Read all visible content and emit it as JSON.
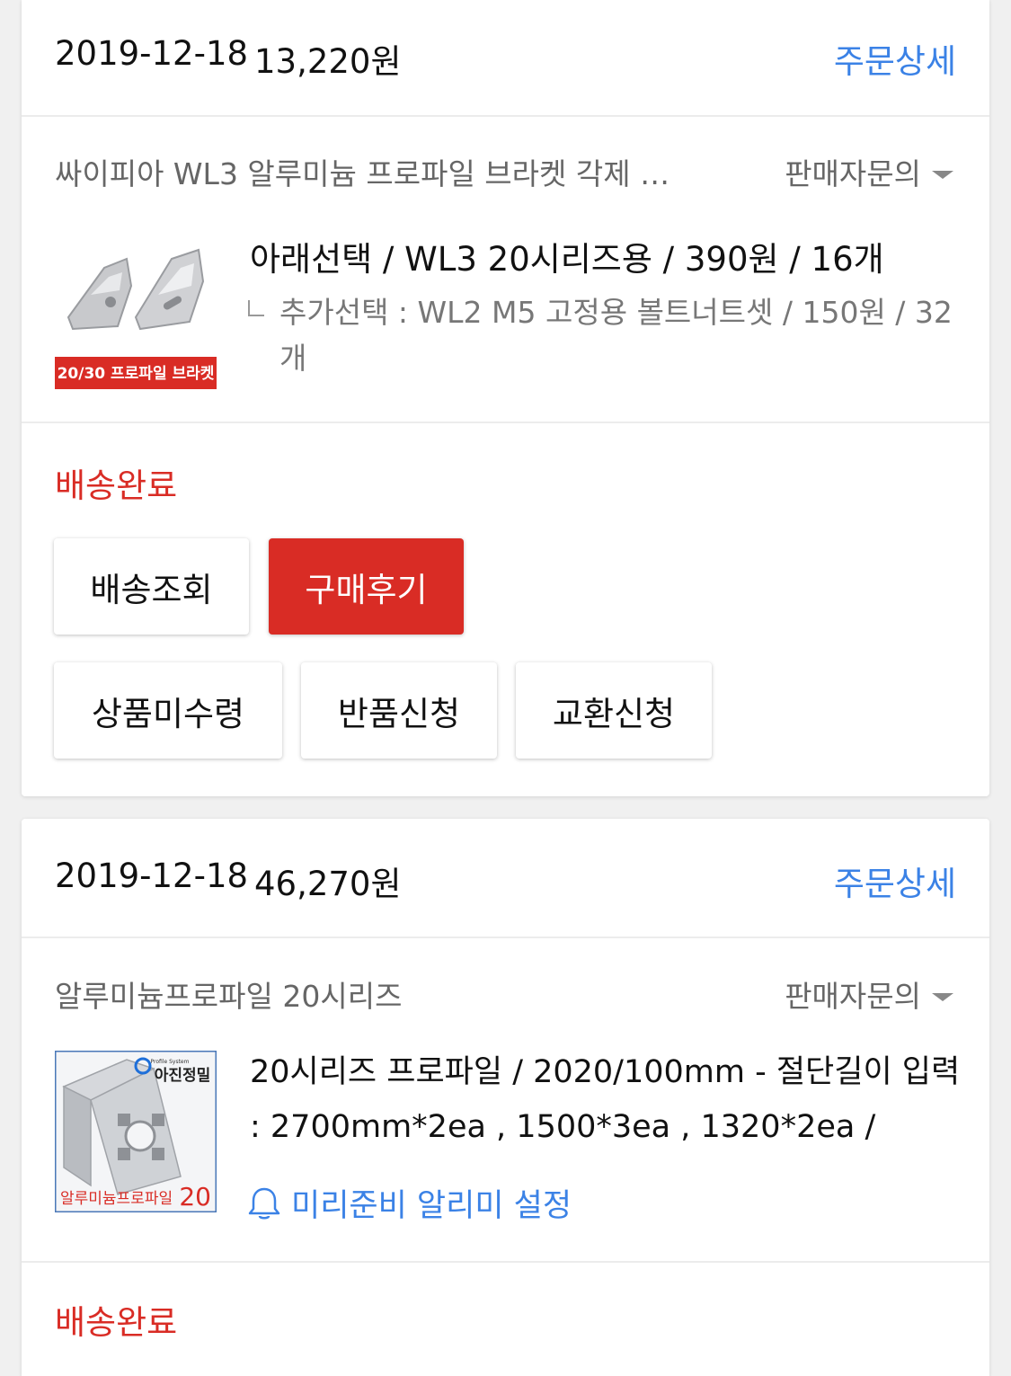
{
  "orders": [
    {
      "date": "2019-12-18",
      "amount": "13,220원",
      "detail_link": "주문상세",
      "product_name": "싸이피아 WL3 알루미늄 프로파일 브라켓 각제 …",
      "seller_inquiry": "판매자문의",
      "thumb_label": "20/30 프로파일 브라켓",
      "option_main": "아래선택 / WL3 20시리즈용 / 390원 / 16개",
      "option_sub": "추가선택 : WL2 M5 고정용 볼트너트셋 / 150원 / 32개",
      "status": "배송완료",
      "buttons": [
        "배송조회",
        "구매후기",
        "상품미수령",
        "반품신청",
        "교환신청"
      ]
    },
    {
      "date": "2019-12-18",
      "amount": "46,270원",
      "detail_link": "주문상세",
      "product_name": "알루미늄프로파일 20시리즈",
      "seller_inquiry": "판매자문의",
      "thumb_brand": "아진정밀",
      "thumb_brand_sub": "Profile System",
      "thumb_label": "알루미늄프로파일",
      "thumb_number": "20",
      "option_main": "20시리즈 프로파일 / 2020/100mm - 절단길이 입력 : 2700mm*2ea , 1500*3ea , 1320*2ea /",
      "alarm": "미리준비 알리미 설정",
      "status": "배송완료"
    }
  ],
  "colors": {
    "link": "#3b82e6",
    "status": "#d92c25",
    "primary_button": "#d92c25"
  }
}
